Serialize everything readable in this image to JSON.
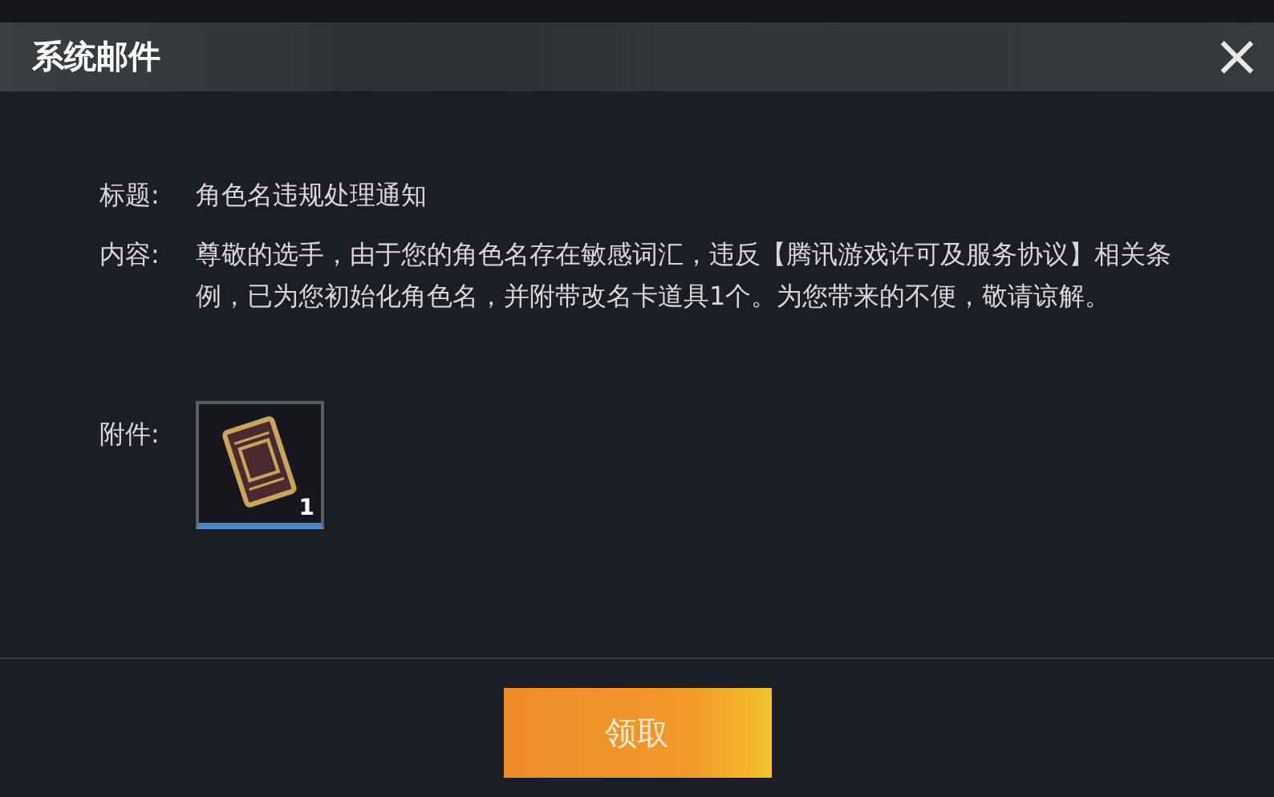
{
  "window": {
    "title": "系统邮件",
    "close": "×"
  },
  "mail": {
    "subject_label": "标题:",
    "subject": "角色名违规处理通知",
    "content_label": "内容:",
    "content": "尊敬的选手，由于您的角色名存在敏感词汇，违反【腾讯游戏许可及服务协议】相关条例，已为您初始化角色名，并附带改名卡道具1个。为您带来的不便，敬请谅解。",
    "attachment_label": "附件:",
    "attachments": [
      {
        "count": "1"
      }
    ]
  },
  "buttons": [
    "领取"
  ]
}
